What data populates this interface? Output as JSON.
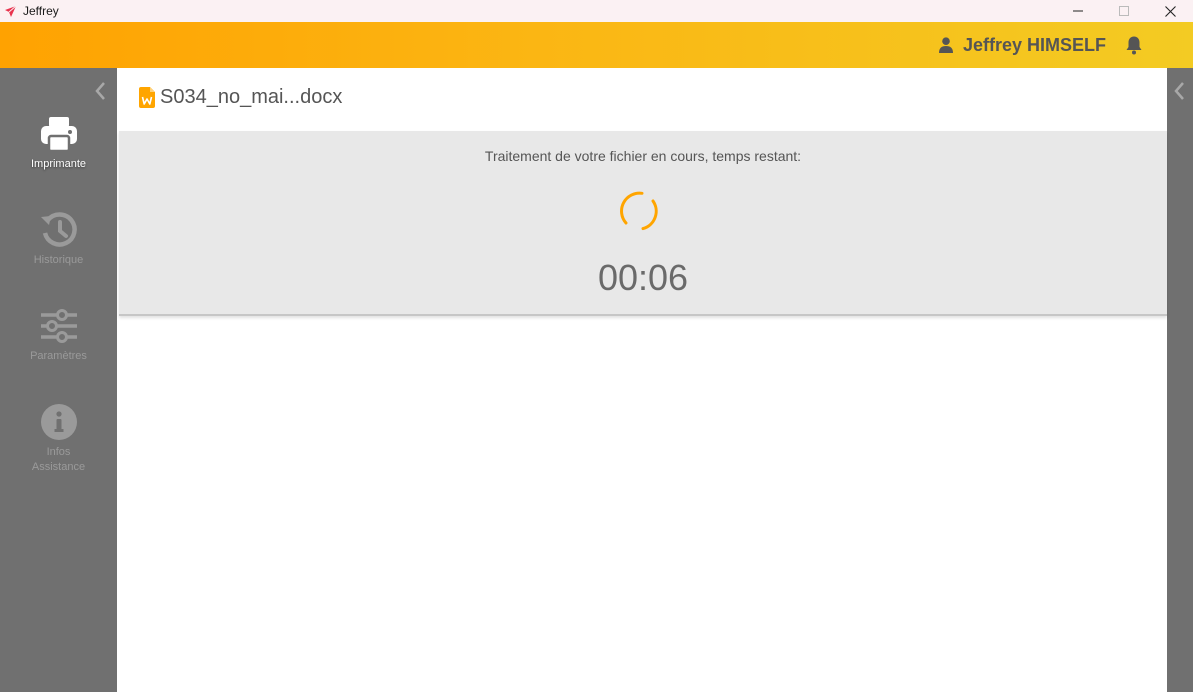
{
  "window": {
    "title": "Jeffrey",
    "logo_icon": "paper-plane-icon",
    "logo_color": "#e8344e"
  },
  "header": {
    "user_name": "Jeffrey HIMSELF",
    "user_icon": "user-icon",
    "notification_icon": "bell-icon",
    "gradient": [
      "#ffa201",
      "#f3cb23"
    ]
  },
  "sidebar": {
    "collapse_icon": "chevron-left-icon",
    "items": [
      {
        "label": "Imprimante",
        "icon": "printer-icon",
        "active": true
      },
      {
        "label": "Historique",
        "icon": "history-icon",
        "active": false
      },
      {
        "label": "Paramètres",
        "icon": "sliders-icon",
        "active": false
      },
      {
        "label_line1": "Infos",
        "label_line2": "Assistance",
        "icon": "info-icon",
        "active": false
      }
    ]
  },
  "document": {
    "name": "S034_no_mai...docx",
    "icon": "word-file-icon",
    "icon_color": "#ffa500"
  },
  "processing": {
    "message": "Traitement de votre fichier en cours, temps restant:",
    "time_remaining": "00:06",
    "spinner_color": "#ffa500"
  }
}
